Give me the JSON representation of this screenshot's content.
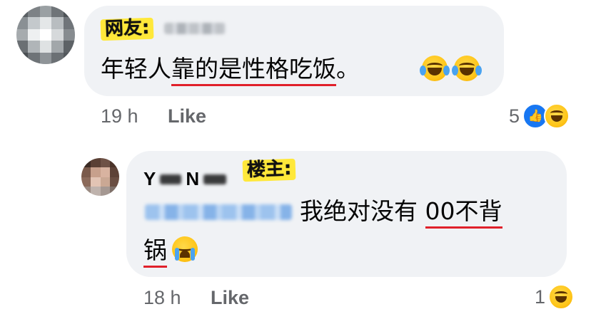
{
  "colors": {
    "bubble": "#f0f2f5",
    "meta_text": "#65676b",
    "like_blue": "#1877f2",
    "underline": "#e0202a",
    "tag_highlight": "#ffe83a"
  },
  "comment": {
    "tag": "网友:",
    "text_pre": "年轻人",
    "text_underlined": "靠的是性格吃饭",
    "text_post": "。",
    "emojis": [
      "tears-of-joy-emoji",
      "tears-of-joy-emoji"
    ],
    "time": "19 h",
    "like_label": "Like",
    "reaction_count": "5",
    "reaction_icons": [
      "like-reaction-icon",
      "haha-reaction-icon"
    ]
  },
  "reply": {
    "author_initial_1": "Y",
    "author_initial_2": "N",
    "tag": "楼主:",
    "text_pre": "我绝对没有 ",
    "text_underlined_1": "00不背",
    "text_underlined_2": "锅",
    "emoji": "loudly-crying-emoji",
    "time": "18 h",
    "like_label": "Like",
    "reaction_count": "1",
    "reaction_icons": [
      "haha-reaction-icon"
    ]
  }
}
